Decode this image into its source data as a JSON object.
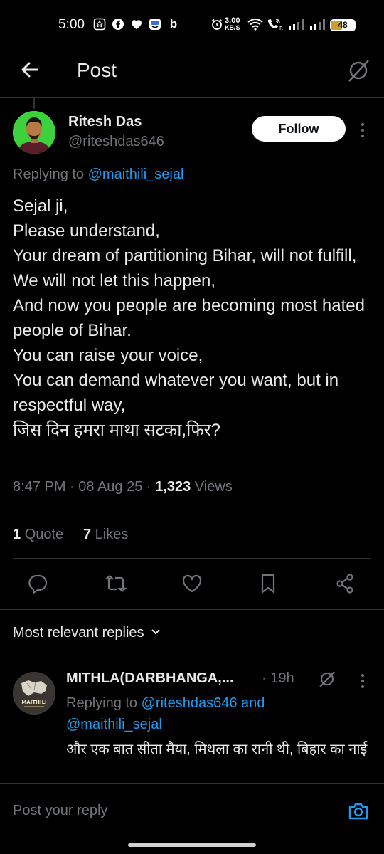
{
  "status_bar": {
    "time": "5:00",
    "network_speed_value": "3.00",
    "network_speed_unit": "KB/S",
    "battery": "48",
    "battery_level": 0.48,
    "notification_icons": [
      "star-badge-icon",
      "facebook-icon",
      "heart-icon",
      "app-icon",
      "b-icon"
    ]
  },
  "header": {
    "title": "Post"
  },
  "post": {
    "author_name": "Ritesh Das",
    "author_handle": "@riteshdas646",
    "follow_label": "Follow",
    "replying_prefix": "Replying to ",
    "replying_to": "@maithili_sejal",
    "text": "Sejal ji,\nPlease understand,\nYour dream of partitioning Bihar, will not fulfill,\nWe will not let this happen,\nAnd now you people are becoming most hated people of Bihar.\nYou can raise your voice,\nYou can demand whatever you want, but in respectful way,\nजिस दिन हमरा माथा सटका,फिर?",
    "time": "8:47 PM",
    "date": "08 Aug 25",
    "views_count": "1,323",
    "views_label": "Views",
    "quote_count": "1",
    "quote_label": "Quote",
    "likes_count": "7",
    "likes_label": "Likes"
  },
  "replies_section": {
    "sort_label": "Most relevant replies"
  },
  "reply": {
    "author_name": "MITHLA(DARBHANGA,...",
    "time": "19h",
    "replying_prefix": "Replying to ",
    "replying_to_1": "@riteshdas646",
    "replying_and": " and",
    "replying_to_2": "@maithili_sejal",
    "text": "और एक बात सीता मैया, मिथला का रानी थी, बिहार का नाई",
    "avatar_text": "MAITHILI"
  },
  "composer": {
    "placeholder": "Post your reply"
  },
  "colors": {
    "background": "#000000",
    "text": "#e7e9ea",
    "muted": "#71767b",
    "link": "#1d9bf0",
    "divider": "#2f3336"
  }
}
